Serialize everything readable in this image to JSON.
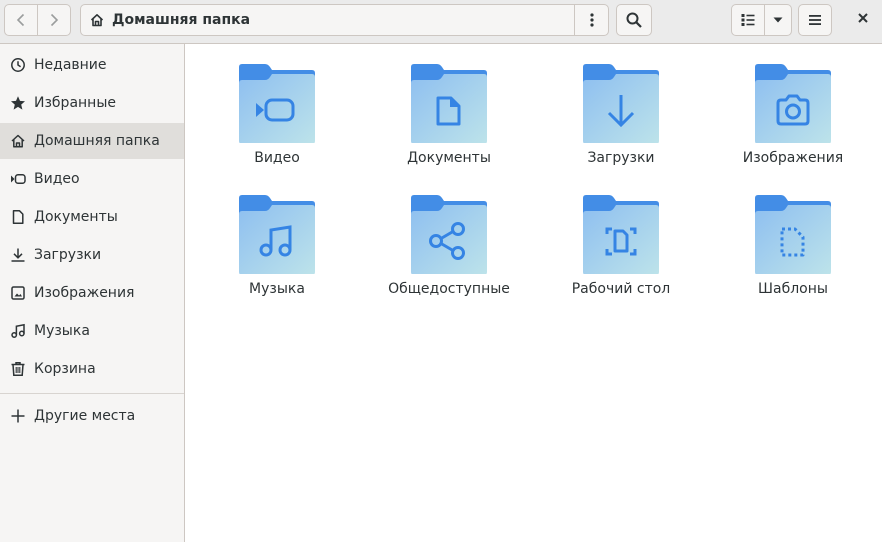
{
  "header": {
    "path_label": "Домашняя папка",
    "icons": {
      "back": "chevron-left-icon",
      "forward": "chevron-right-icon",
      "home": "home-icon",
      "path_menu": "vertical-dots-icon",
      "search": "search-icon",
      "view": "list-view-icon",
      "view_dropdown": "triangle-down-icon",
      "menu": "hamburger-icon",
      "close": "close-icon"
    }
  },
  "sidebar": {
    "items": [
      {
        "label": "Недавние",
        "icon": "clock-icon"
      },
      {
        "label": "Избранные",
        "icon": "star-icon"
      },
      {
        "label": "Домашняя папка",
        "icon": "home-icon",
        "active": true
      },
      {
        "label": "Видео",
        "icon": "video-icon"
      },
      {
        "label": "Документы",
        "icon": "document-icon"
      },
      {
        "label": "Загрузки",
        "icon": "download-icon"
      },
      {
        "label": "Изображения",
        "icon": "image-icon"
      },
      {
        "label": "Музыка",
        "icon": "music-icon"
      },
      {
        "label": "Корзина",
        "icon": "trash-icon"
      }
    ],
    "other": {
      "label": "Другие места",
      "icon": "plus-icon"
    }
  },
  "folders": [
    {
      "label": "Видео",
      "icon": "video-icon"
    },
    {
      "label": "Документы",
      "icon": "document-icon"
    },
    {
      "label": "Загрузки",
      "icon": "download-icon"
    },
    {
      "label": "Изображения",
      "icon": "camera-icon"
    },
    {
      "label": "Музыка",
      "icon": "music-icon"
    },
    {
      "label": "Общедоступные",
      "icon": "share-icon"
    },
    {
      "label": "Рабочий стол",
      "icon": "desktop-icon"
    },
    {
      "label": "Шаблоны",
      "icon": "template-icon"
    }
  ],
  "colors": {
    "folder_back": "#438de6",
    "folder_front_top": "#8ebff0",
    "folder_front_bottom": "#b6dcec",
    "folder_glyph": "#3584e4",
    "sidebar_bg": "#f6f5f4",
    "sidebar_active": "#e0dedb",
    "header_bg": "#ebebeb"
  }
}
